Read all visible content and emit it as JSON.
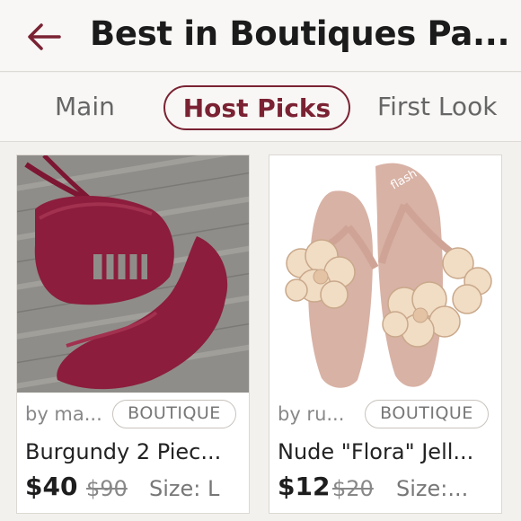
{
  "header": {
    "title": "Best in Boutiques Pa...",
    "back_icon": "arrow-left-icon",
    "accent_color": "#7a2233"
  },
  "tabs": [
    {
      "label": "Main",
      "active": false
    },
    {
      "label": "Host Picks",
      "active": true
    },
    {
      "label": "First Look",
      "active": false
    }
  ],
  "listings": [
    {
      "seller": "by ma...",
      "badge": "BOUTIQUE",
      "title": "Burgundy 2 Piec...",
      "price": "$40",
      "original_price": "$90",
      "size": "Size: L",
      "image": "burgundy-bikini-image"
    },
    {
      "seller": "by ru...",
      "badge": "BOUTIQUE",
      "title": "Nude \"Flora\" Jell...",
      "price": "$12",
      "original_price": "$20",
      "size": "Size:...",
      "image": "nude-flower-sandals-image"
    }
  ]
}
